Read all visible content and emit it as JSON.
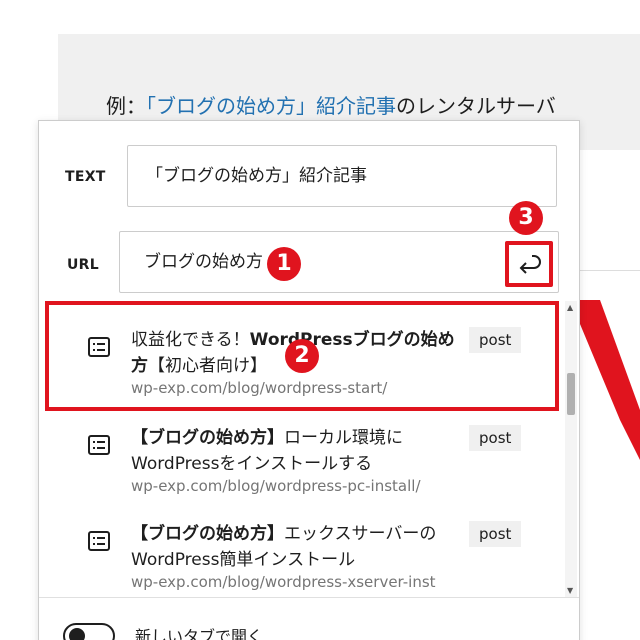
{
  "background": {
    "example_prefix": "例：",
    "example_link": "「ブログの始め方」紹介記事",
    "example_suffix": "のレンタルサーバ"
  },
  "link_popover": {
    "text_label": "TEXT",
    "text_value": "「ブログの始め方」紹介記事",
    "url_label": "URL",
    "url_value": "ブログの始め方",
    "submit_icon": "enter-return-icon",
    "suggestions": [
      {
        "title_pre": "収益化できる！",
        "title_bold": "WordPressブログの始め方",
        "title_post": "【初心者向け】",
        "url": "wp-exp.com/blog/wordpress-start/",
        "type": "post",
        "icon": "post-list-icon"
      },
      {
        "title_pre": "",
        "title_bold": "【ブログの始め方】",
        "title_post": "ローカル環境にWordPressをインストールする",
        "url": "wp-exp.com/blog/wordpress-pc-install/",
        "type": "post",
        "icon": "post-list-icon"
      },
      {
        "title_pre": "",
        "title_bold": "【ブログの始め方】",
        "title_post": "エックスサーバーのWordPress簡単インストール",
        "url": "wp-exp.com/blog/wordpress-xserver-inst",
        "type": "post",
        "icon": "post-list-icon"
      }
    ],
    "new_tab_label": "新しいタブで開く",
    "new_tab_enabled": false
  },
  "annotations": {
    "badge1": "1",
    "badge2": "2",
    "badge3": "3",
    "accent_color": "#e0141e"
  }
}
